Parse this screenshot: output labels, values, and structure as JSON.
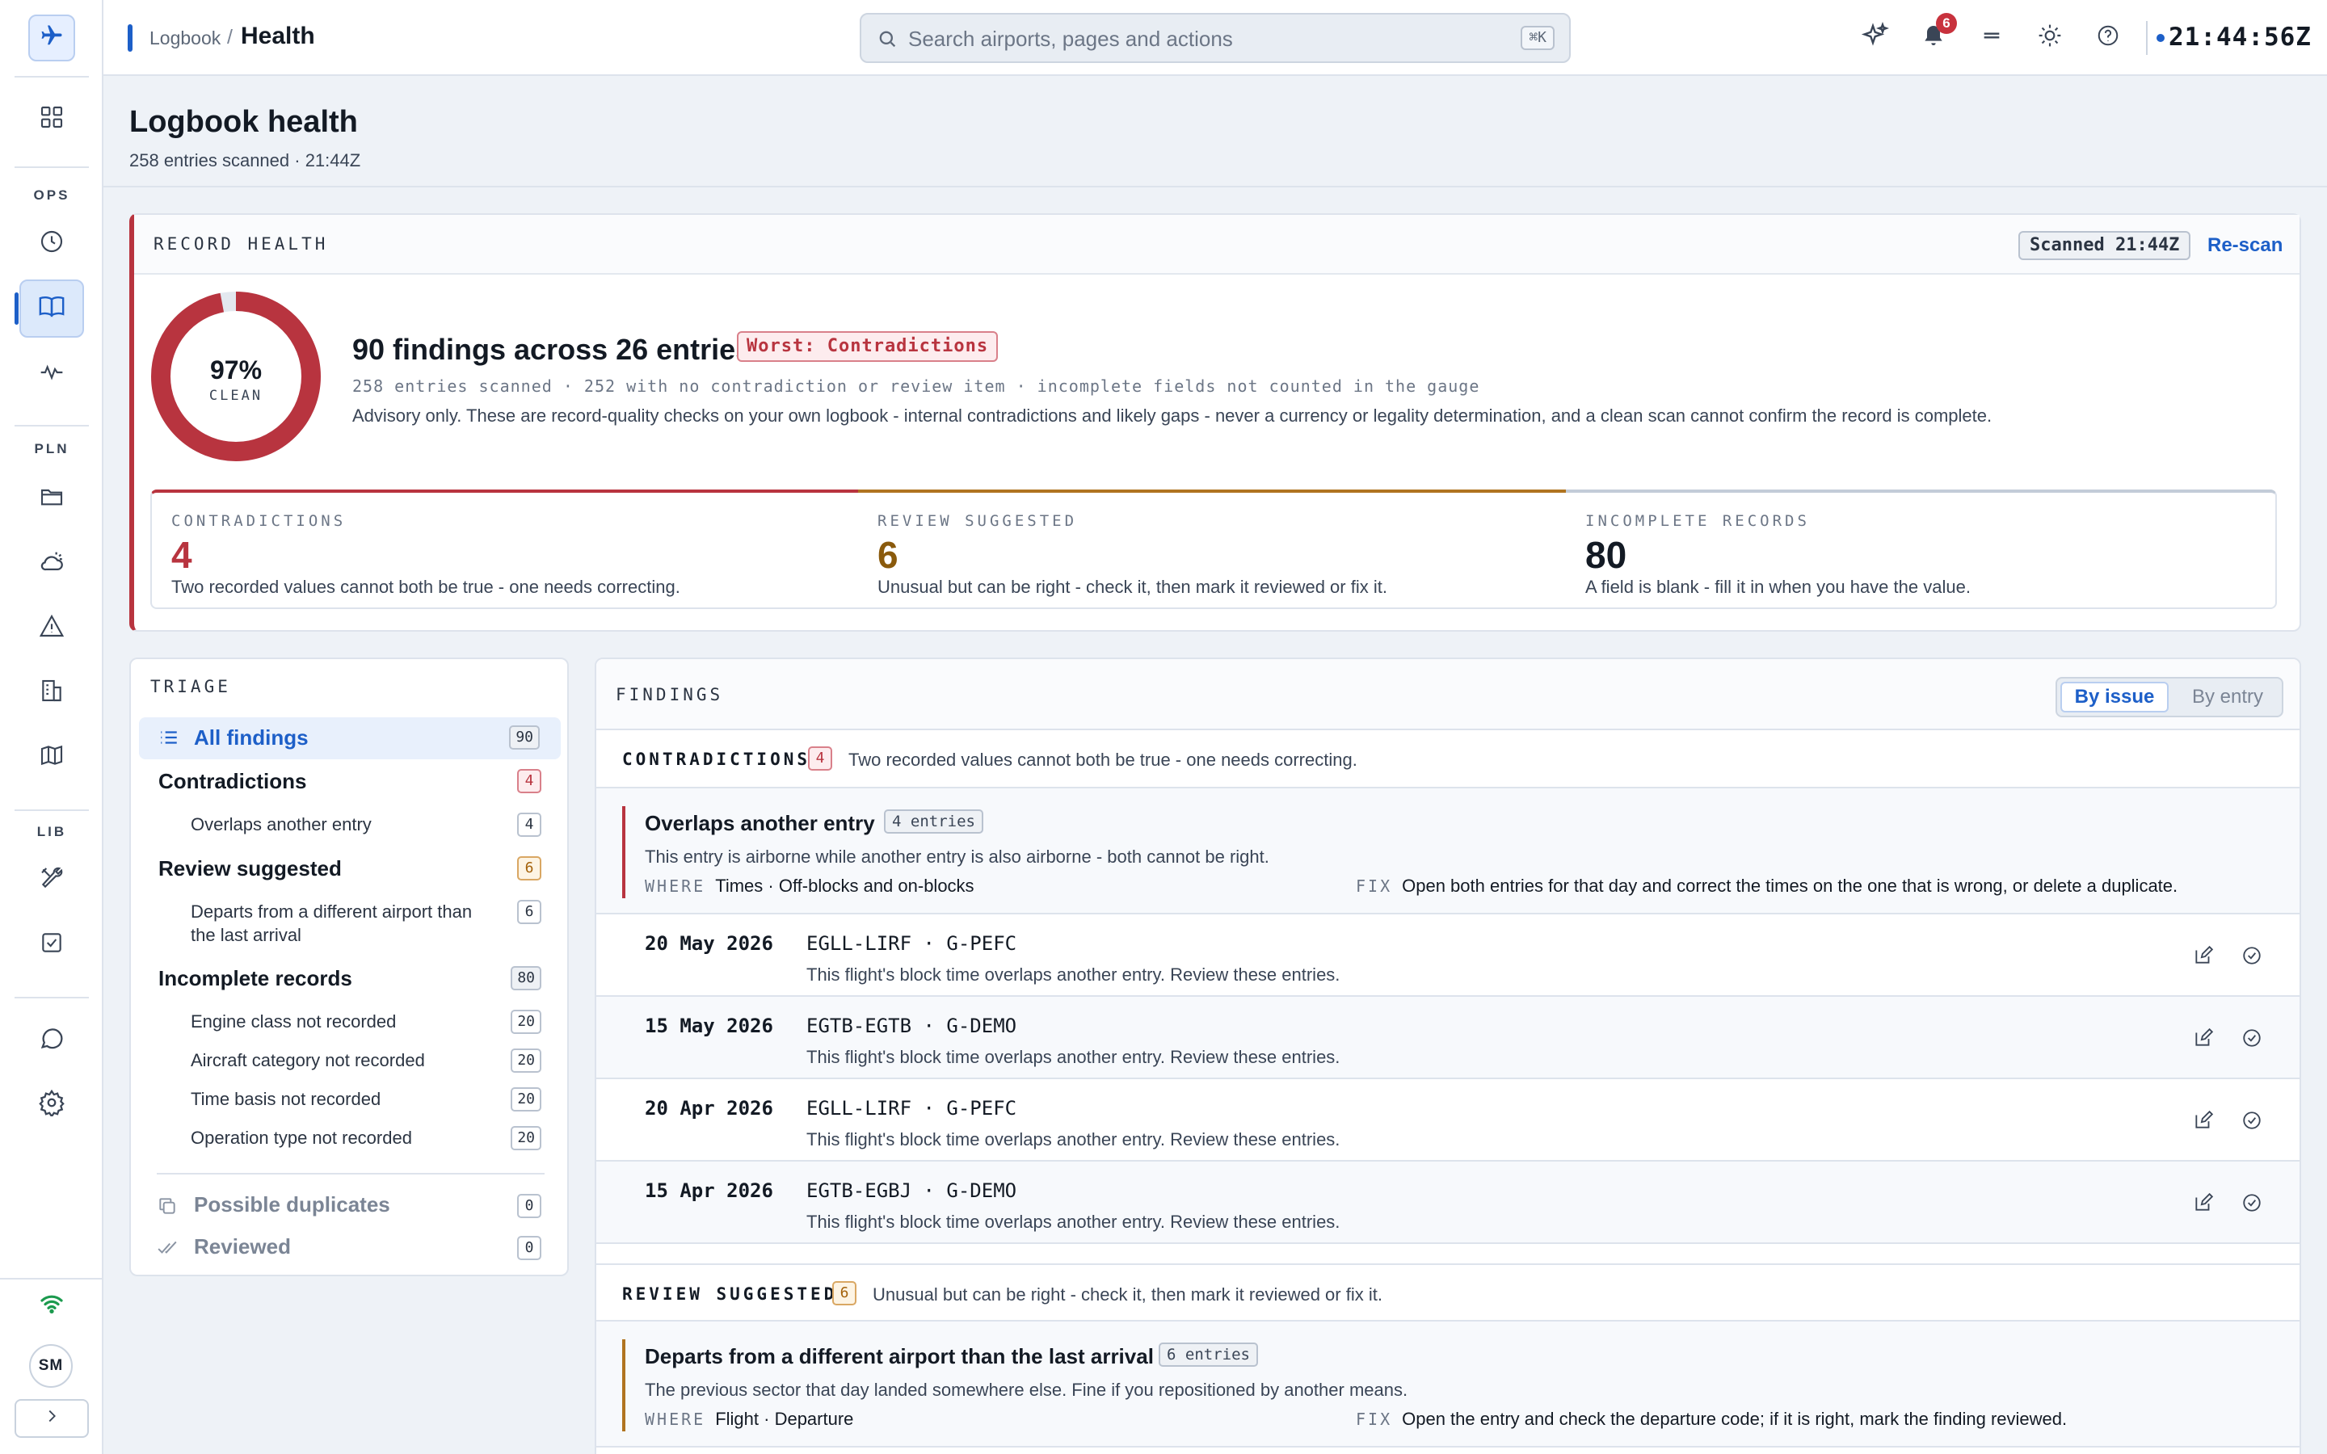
{
  "header": {
    "breadcrumb_parent": "Logbook",
    "breadcrumb_separator": "/",
    "breadcrumb_current": "Health",
    "search_placeholder": "Search airports, pages and actions",
    "search_shortcut": "⌘K",
    "notification_count": "6",
    "clock": "21:44:56Z"
  },
  "sidebar": {
    "sections": [
      "OPS",
      "PLN",
      "LIB"
    ],
    "user_initials": "SM",
    "icons": [
      "dashboard-icon",
      "clock-icon",
      "logbook-icon",
      "activity-icon",
      "folder-icon",
      "weather-icon",
      "warning-icon",
      "building-icon",
      "map-icon",
      "tools-icon",
      "checklist-icon",
      "chat-icon",
      "settings-icon",
      "wifi-icon",
      "chevron-right-icon"
    ]
  },
  "page": {
    "title": "Logbook health",
    "subtitle": "258 entries scanned · 21:44Z"
  },
  "health": {
    "eyebrow": "RECORD HEALTH",
    "scanned_chip": "Scanned 21:44Z",
    "rescan_label": "Re-scan",
    "gauge_percent": "97%",
    "gauge_label": "CLEAN",
    "gauge_fraction": 0.97,
    "summary_title": "90 findings across 26 entries",
    "worst_chip": "Worst: Contradictions",
    "summary_meta": "258 entries scanned · 252 with no contradiction or review item · incomplete fields not counted in the gauge",
    "summary_note": "Advisory only. These are record-quality checks on your own logbook - internal contradictions and likely gaps - never a currency or legality determination, and a clean scan cannot confirm the record is complete.",
    "stats": [
      {
        "label": "CONTRADICTIONS",
        "value": "4",
        "desc": "Two recorded values cannot both be true - one needs correcting.",
        "color": "#b8343f"
      },
      {
        "label": "REVIEW SUGGESTED",
        "value": "6",
        "desc": "Unusual but can be right - check it, then mark it reviewed or fix it.",
        "color": "#8a5a0c"
      },
      {
        "label": "INCOMPLETE RECORDS",
        "value": "80",
        "desc": "A field is blank - fill it in when you have the value.",
        "color": "#131a24"
      }
    ]
  },
  "triage": {
    "eyebrow": "TRIAGE",
    "all_label": "All findings",
    "all_count": "90",
    "contradictions": {
      "label": "Contradictions",
      "count": "4",
      "items": [
        {
          "label": "Overlaps another entry",
          "count": "4"
        }
      ]
    },
    "review": {
      "label": "Review suggested",
      "count": "6",
      "items": [
        {
          "label": "Departs from a different airport than the last arrival",
          "count": "6"
        }
      ]
    },
    "incomplete": {
      "label": "Incomplete records",
      "count": "80",
      "items": [
        {
          "label": "Engine class not recorded",
          "count": "20"
        },
        {
          "label": "Aircraft category not recorded",
          "count": "20"
        },
        {
          "label": "Time basis not recorded",
          "count": "20"
        },
        {
          "label": "Operation type not recorded",
          "count": "20"
        }
      ]
    },
    "duplicates": {
      "label": "Possible duplicates",
      "count": "0"
    },
    "reviewed": {
      "label": "Reviewed",
      "count": "0"
    }
  },
  "findings": {
    "eyebrow": "FINDINGS",
    "toggle_on": "By issue",
    "toggle_off": "By entry",
    "where_kw": "WHERE",
    "fix_kw": "FIX",
    "groups": [
      {
        "title": "CONTRADICTIONS",
        "count": "4",
        "desc": "Two recorded values cannot both be true - one needs correcting.",
        "issue": {
          "title": "Overlaps another entry",
          "chip": "4 entries",
          "desc": "This entry is airborne while another entry is also airborne - both cannot be right.",
          "where": "Times · Off-blocks and on-blocks",
          "fix": "Open both entries for that day and correct the times on the one that is wrong, or delete a duplicate."
        },
        "entries": [
          {
            "date": "20 May 2026",
            "route": "EGLL-LIRF · G-PEFC",
            "desc": "This flight's block time overlaps another entry. Review these entries."
          },
          {
            "date": "15 May 2026",
            "route": "EGTB-EGTB · G-DEMO",
            "desc": "This flight's block time overlaps another entry. Review these entries."
          },
          {
            "date": "20 Apr 2026",
            "route": "EGLL-LIRF · G-PEFC",
            "desc": "This flight's block time overlaps another entry. Review these entries."
          },
          {
            "date": "15 Apr 2026",
            "route": "EGTB-EGBJ · G-DEMO",
            "desc": "This flight's block time overlaps another entry. Review these entries."
          }
        ]
      },
      {
        "title": "REVIEW SUGGESTED",
        "count": "6",
        "desc": "Unusual but can be right - check it, then mark it reviewed or fix it.",
        "issue": {
          "title": "Departs from a different airport than the last arrival",
          "chip": "6 entries",
          "desc": "The previous sector that day landed somewhere else. Fine if you repositioned by another means.",
          "where": "Flight · Departure",
          "fix": "Open the entry and check the departure code; if it is right, mark the finding reviewed."
        }
      }
    ]
  }
}
